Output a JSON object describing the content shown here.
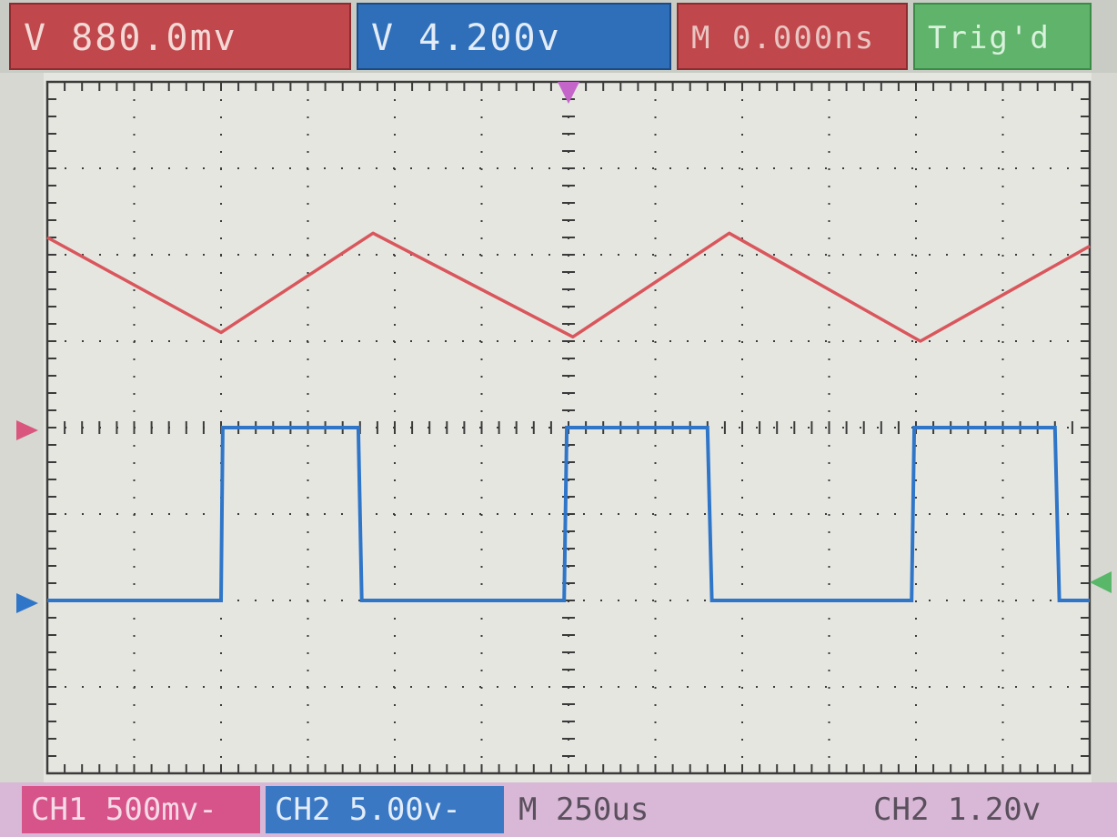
{
  "header": {
    "ch1_readout": "V 880.0mv",
    "ch2_readout": "V 4.200v",
    "time_readout": "M 0.000ns",
    "trigger_status": "Trig'd"
  },
  "footer": {
    "ch1_scale": "CH1 500mv-",
    "ch2_scale": "CH2 5.00v-",
    "timebase": "M 250us",
    "trigger_level": "CH2 1.20v"
  },
  "colors": {
    "ch1": "#d9575c",
    "ch2": "#2f76c9",
    "grid": "#3b3b3b",
    "screen": "#e6e6e1",
    "ch1_marker": "#d9577e",
    "trigger_marker": "#58b768",
    "trigger_pos_marker": "#c466c9"
  },
  "chart_data": {
    "type": "line",
    "grid": true,
    "x_divisions": 12,
    "y_divisions": 8,
    "xlim": [
      0,
      12
    ],
    "ylim": [
      0,
      8
    ],
    "series": [
      {
        "name": "CH1",
        "x": [
          0,
          2.0,
          3.75,
          6.05,
          7.85,
          10.05,
          12.0
        ],
        "y": [
          6.2,
          5.1,
          6.25,
          5.05,
          6.25,
          5.0,
          6.1
        ]
      },
      {
        "name": "CH2",
        "x": [
          0,
          2.0,
          2.02,
          3.58,
          3.62,
          5.95,
          5.98,
          7.6,
          7.65,
          9.95,
          9.98,
          11.6,
          11.65,
          12.0
        ],
        "y": [
          2.0,
          2.0,
          4.0,
          4.0,
          2.0,
          2.0,
          4.0,
          4.0,
          2.0,
          2.0,
          4.0,
          4.0,
          2.0,
          2.0
        ]
      }
    ]
  }
}
